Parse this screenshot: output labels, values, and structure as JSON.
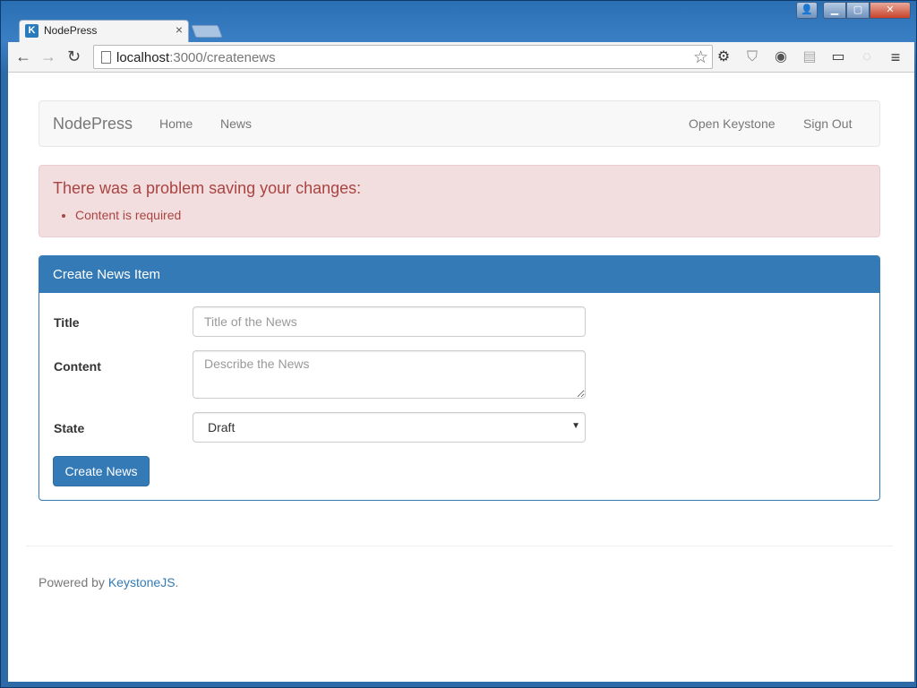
{
  "browser": {
    "tab_title": "NodePress",
    "tab_favicon_letter": "K",
    "tab_close": "×",
    "url_host": "localhost",
    "url_path": ":3000/createnews",
    "window_controls": {
      "user": "👤",
      "minimize": "▁",
      "maximize": "▢",
      "close": "✕"
    },
    "nav": {
      "back": "←",
      "forward": "→",
      "reload": "↻"
    },
    "star": "☆",
    "extensions": [
      "⚙",
      "⛉",
      "◉",
      "▤",
      "▭",
      "◌",
      "≡"
    ]
  },
  "navbar": {
    "brand": "NodePress",
    "links_left": [
      "Home",
      "News"
    ],
    "links_right": [
      "Open Keystone",
      "Sign Out"
    ]
  },
  "alert": {
    "heading": "There was a problem saving your changes:",
    "errors": [
      "Content is required"
    ],
    "color": "#a94442"
  },
  "form": {
    "panel_title": "Create News Item",
    "title_label": "Title",
    "title_placeholder": "Title of the News",
    "content_label": "Content",
    "content_placeholder": "Describe the News",
    "state_label": "State",
    "state_selected": "Draft",
    "submit_label": "Create News"
  },
  "footer": {
    "prefix": "Powered by ",
    "link": "KeystoneJS",
    "suffix": "."
  },
  "colors": {
    "primary": "#337ab7",
    "alert_bg": "#f2dede"
  }
}
